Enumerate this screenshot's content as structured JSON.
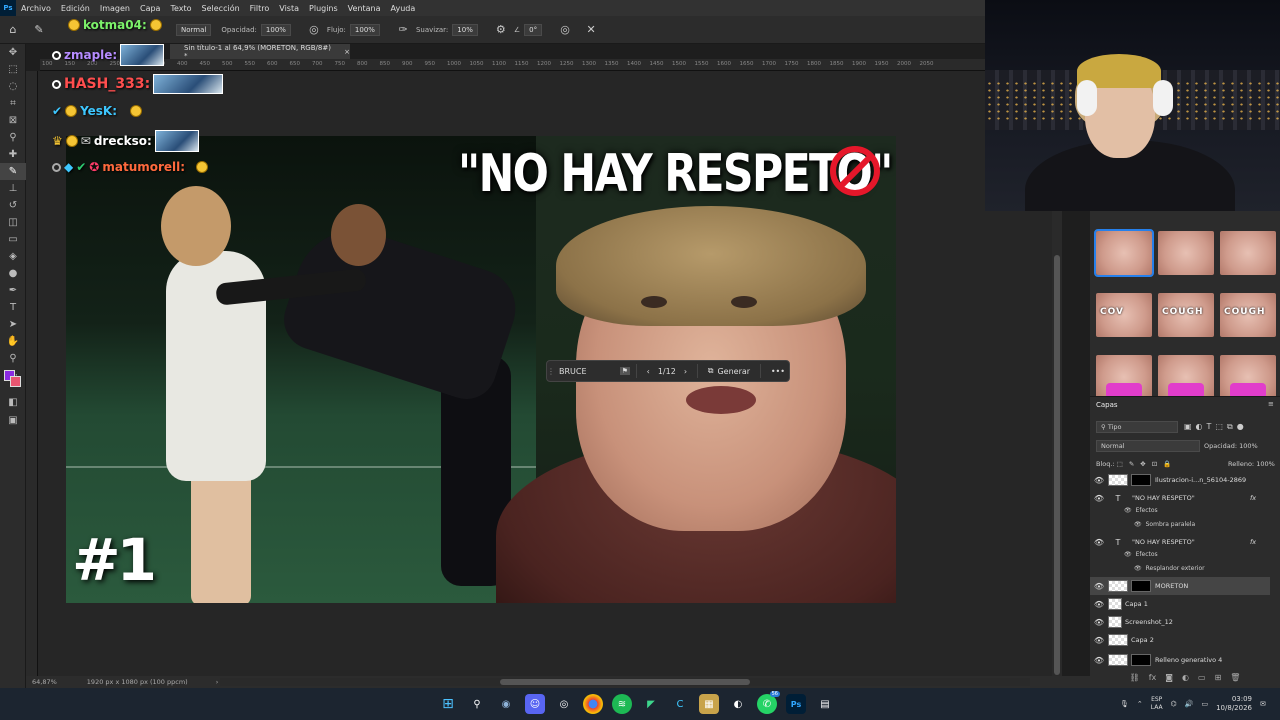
{
  "menu": {
    "logo": "Ps",
    "items": [
      "Archivo",
      "Edición",
      "Imagen",
      "Capa",
      "Texto",
      "Selección",
      "Filtro",
      "Vista",
      "Plugins",
      "Ventana",
      "Ayuda"
    ]
  },
  "options": {
    "mode_value": "Normal",
    "opacity_label": "Opacidad:",
    "opacity_value": "100%",
    "flow_label": "Flujo:",
    "flow_value": "100%",
    "smoothing_label": "Suavizar:",
    "smoothing_value": "10%",
    "angle_value": "0°"
  },
  "document": {
    "tab_title": "Sin título-1 al 64,9% (MORETON, RGB/8#) *",
    "close_glyph": "×"
  },
  "ruler_ticks": [
    "100",
    "150",
    "200",
    "250",
    "300",
    "350",
    "400",
    "450",
    "500",
    "550",
    "600",
    "650",
    "700",
    "750",
    "800",
    "850",
    "900",
    "950",
    "1000",
    "1050",
    "1100",
    "1150",
    "1200",
    "1250",
    "1300",
    "1350",
    "1400",
    "1450",
    "1500",
    "1550",
    "1600",
    "1650",
    "1700",
    "1750",
    "1800",
    "1850",
    "1900",
    "1950",
    "2000",
    "2050"
  ],
  "artwork": {
    "headline": "\"NO HAY RESPETO\"",
    "number": "#1"
  },
  "context_bar": {
    "prompt_value": "BRUCE",
    "counter": "1/12",
    "generate_label": "Generar",
    "more_glyph": "•••"
  },
  "chat": {
    "lines": [
      {
        "user": "kotma04:",
        "color": "#7cf26a"
      },
      {
        "user": "zmaple:",
        "color": "#b68cff"
      },
      {
        "user": "HASH_333:",
        "color": "#ff4e4e"
      },
      {
        "user": "YesK:",
        "color": "#3ec7ff"
      },
      {
        "user": "drecksо:",
        "color": "#ffffff"
      },
      {
        "user": "matumorell:",
        "color": "#ff6a3d"
      }
    ]
  },
  "thumbnails": [
    {
      "label": "",
      "pink": false,
      "selected": true
    },
    {
      "label": "",
      "pink": false,
      "selected": false
    },
    {
      "label": "",
      "pink": false,
      "selected": false
    },
    {
      "label": "COV",
      "pink": false,
      "selected": false
    },
    {
      "label": "COUGH",
      "pink": false,
      "selected": false
    },
    {
      "label": "COUGH",
      "pink": false,
      "selected": false
    },
    {
      "label": "",
      "pink": true,
      "selected": false
    },
    {
      "label": "",
      "pink": true,
      "selected": false
    },
    {
      "label": "",
      "pink": true,
      "selected": false
    }
  ],
  "layers": {
    "title": "Capas",
    "search_value": "Tipo",
    "blend_value": "Normal",
    "opacity_label": "Opacidad:",
    "opacity_value": "100%",
    "lock_label": "Bloq.:",
    "fill_label": "Relleno:",
    "fill_value": "100%",
    "rows": {
      "ilustracion": "Ilustracion-i...n_56104-2869",
      "text1": "\"NO HAY RESPETO\"",
      "effects1": "Efectos",
      "effect1": "Sombra paralela",
      "text2": "\"NO HAY RESPETO\"",
      "effects2": "Efectos",
      "effect2": "Resplandor exterior",
      "moreton": "MORETON",
      "capa1": "Capa 1",
      "screenshot": "Screenshot_12",
      "capa2": "Capa 2",
      "relleno": "Relleno generativo 4"
    },
    "fx_glyph": "fx"
  },
  "status": {
    "zoom": "64,87%",
    "doc_size": "1920 px x 1080 px (100 ppcm)"
  },
  "taskbar": {
    "lang_top": "ESP",
    "lang_bottom": "LAA",
    "time": "03:09",
    "date": "10/8/2026",
    "discord_badge": "",
    "whatsapp_badge": "56"
  },
  "colors": {
    "foreground": "#8a2be2",
    "background": "#e85570",
    "selection": "#2680eb"
  }
}
